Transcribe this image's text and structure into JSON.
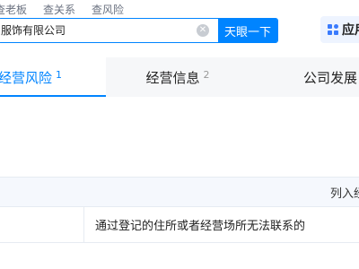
{
  "top_links": [
    "查老板",
    "查关系",
    "查风险"
  ],
  "search": {
    "value": "服饰有限公司",
    "button_label": "天眼一下"
  },
  "app_button": {
    "label": "应用"
  },
  "tabs": [
    {
      "label": "经营风险",
      "count": "1",
      "active": true
    },
    {
      "label": "经营信息",
      "count": "2",
      "active": false
    },
    {
      "label": "公司发展",
      "count": "",
      "active": false
    }
  ],
  "table": {
    "header": "列入经",
    "row_reason": "通过登记的住所或者经营场所无法联系的"
  },
  "colors": {
    "accent": "#0084ff",
    "tab_inactive_bg": "#f6f7f9",
    "table_header_bg": "#f5f8fd"
  }
}
